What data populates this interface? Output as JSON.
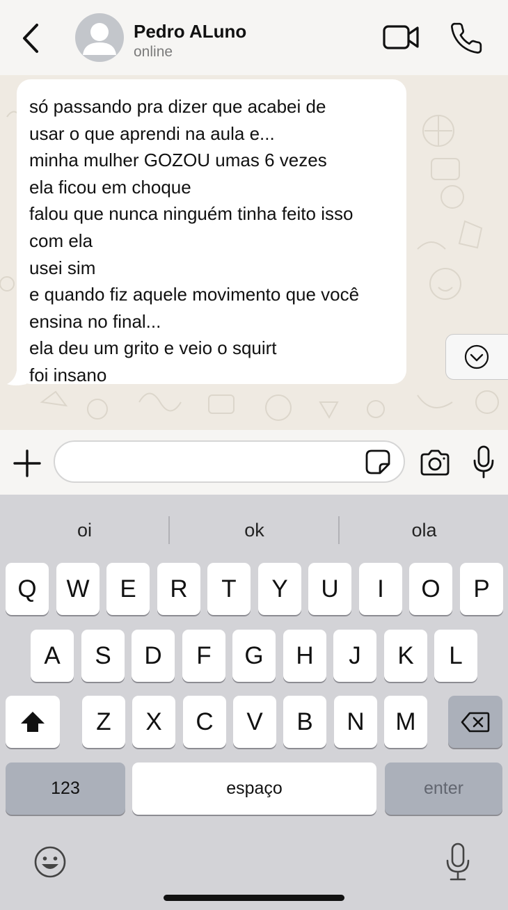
{
  "header": {
    "contact_name": "Pedro ALuno",
    "status": "online",
    "icons": [
      "back-arrow-icon",
      "avatar-placeholder",
      "video-call-icon",
      "phone-call-icon"
    ]
  },
  "chat": {
    "wallpaper": "doodle-pattern",
    "message": {
      "direction": "incoming",
      "lines": [
        "só passando pra dizer que acabei de",
        "usar o que aprendi na aula e...",
        "minha mulher GOZOU umas 6 vezes",
        "ela ficou em choque",
        "falou que nunca ninguém tinha feito isso",
        "com ela",
        "usei sim",
        "e quando fiz aquele movimento que você",
        "ensina no final...",
        "ela deu um grito e veio o squirt",
        "foi insano"
      ]
    },
    "scroll_button_icon": "chevron-down-circle-icon"
  },
  "composer": {
    "value": "",
    "icons": [
      "plus-icon",
      "sticker-icon",
      "camera-icon",
      "microphone-icon"
    ]
  },
  "keyboard": {
    "suggestions": [
      "oi",
      "ok",
      "ola"
    ],
    "row1": [
      "Q",
      "W",
      "E",
      "R",
      "T",
      "Y",
      "U",
      "I",
      "O",
      "P"
    ],
    "row2": [
      "A",
      "S",
      "D",
      "F",
      "G",
      "H",
      "J",
      "K",
      "L"
    ],
    "row3": [
      "Z",
      "X",
      "C",
      "V",
      "B",
      "N",
      "M"
    ],
    "numbers_label": "123",
    "space_label": "espaço",
    "enter_label": "enter",
    "icons": [
      "shift-icon",
      "backspace-icon",
      "emoji-icon",
      "dictation-icon"
    ]
  },
  "colors": {
    "chat_background": "#efeae2",
    "bubble": "#ffffff",
    "header": "#f6f5f3",
    "keyboard": "#d3d3d7"
  }
}
